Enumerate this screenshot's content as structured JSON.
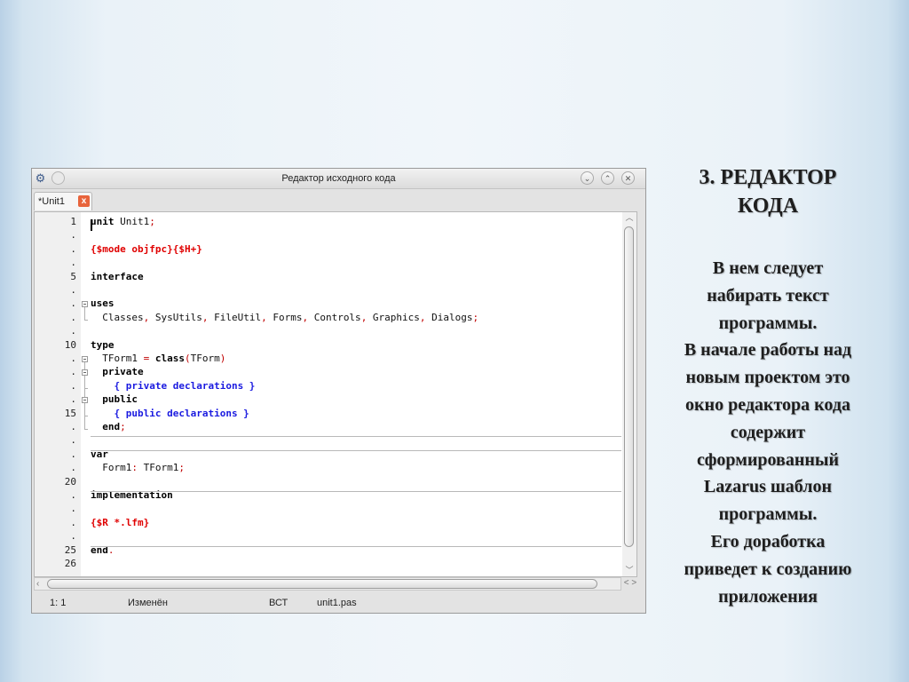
{
  "window": {
    "title": "Редактор исходного кода",
    "controls": [
      "chevron-down",
      "chevron-up",
      "close"
    ]
  },
  "tab": {
    "label": "*Unit1",
    "close_symbol": "x"
  },
  "editor": {
    "gutter": [
      {
        "row": 0,
        "label": "1"
      },
      {
        "row": 1,
        "label": "."
      },
      {
        "row": 2,
        "label": "."
      },
      {
        "row": 3,
        "label": "."
      },
      {
        "row": 4,
        "label": "5"
      },
      {
        "row": 5,
        "label": "."
      },
      {
        "row": 6,
        "label": "."
      },
      {
        "row": 7,
        "label": "."
      },
      {
        "row": 8,
        "label": "."
      },
      {
        "row": 9,
        "label": "10"
      },
      {
        "row": 10,
        "label": "."
      },
      {
        "row": 11,
        "label": "."
      },
      {
        "row": 12,
        "label": "."
      },
      {
        "row": 13,
        "label": "."
      },
      {
        "row": 14,
        "label": "15"
      },
      {
        "row": 15,
        "label": "."
      },
      {
        "row": 16,
        "label": "."
      },
      {
        "row": 17,
        "label": "."
      },
      {
        "row": 18,
        "label": "."
      },
      {
        "row": 19,
        "label": "20"
      },
      {
        "row": 20,
        "label": "."
      },
      {
        "row": 21,
        "label": "."
      },
      {
        "row": 22,
        "label": "."
      },
      {
        "row": 23,
        "label": "."
      },
      {
        "row": 24,
        "label": "25"
      },
      {
        "row": 25,
        "label": "26"
      }
    ],
    "lines": [
      {
        "row": 0,
        "tokens": [
          [
            "kw",
            "unit"
          ],
          [
            "t",
            " Unit1"
          ],
          [
            "sym",
            ";"
          ]
        ]
      },
      {
        "row": 2,
        "tokens": [
          [
            "dir",
            "{$mode objfpc}{$H+}"
          ]
        ]
      },
      {
        "row": 4,
        "tokens": [
          [
            "kw",
            "interface"
          ]
        ]
      },
      {
        "row": 6,
        "tokens": [
          [
            "kw",
            "uses"
          ]
        ]
      },
      {
        "row": 7,
        "tokens": [
          [
            "t",
            "  Classes"
          ],
          [
            "sym",
            ","
          ],
          [
            "t",
            " SysUtils"
          ],
          [
            "sym",
            ","
          ],
          [
            "t",
            " FileUtil"
          ],
          [
            "sym",
            ","
          ],
          [
            "t",
            " Forms"
          ],
          [
            "sym",
            ","
          ],
          [
            "t",
            " Controls"
          ],
          [
            "sym",
            ","
          ],
          [
            "t",
            " Graphics"
          ],
          [
            "sym",
            ","
          ],
          [
            "t",
            " Dialogs"
          ],
          [
            "sym",
            ";"
          ]
        ]
      },
      {
        "row": 9,
        "tokens": [
          [
            "kw",
            "type"
          ]
        ]
      },
      {
        "row": 10,
        "tokens": [
          [
            "t",
            "  TForm1 "
          ],
          [
            "sym",
            "="
          ],
          [
            "t",
            " "
          ],
          [
            "kw",
            "class"
          ],
          [
            "sym",
            "("
          ],
          [
            "t",
            "TForm"
          ],
          [
            "sym",
            ")"
          ]
        ]
      },
      {
        "row": 11,
        "tokens": [
          [
            "kw",
            "  private"
          ]
        ]
      },
      {
        "row": 12,
        "tokens": [
          [
            "cm",
            "    { private declarations }"
          ]
        ]
      },
      {
        "row": 13,
        "tokens": [
          [
            "kw",
            "  public"
          ]
        ]
      },
      {
        "row": 14,
        "tokens": [
          [
            "cm",
            "    { public declarations }"
          ]
        ]
      },
      {
        "row": 15,
        "tokens": [
          [
            "kw",
            "  end"
          ],
          [
            "sym",
            ";"
          ]
        ]
      },
      {
        "row": 17,
        "tokens": [
          [
            "kw",
            "var"
          ]
        ]
      },
      {
        "row": 18,
        "tokens": [
          [
            "t",
            "  Form1"
          ],
          [
            "sym",
            ":"
          ],
          [
            "t",
            " TForm1"
          ],
          [
            "sym",
            ";"
          ]
        ]
      },
      {
        "row": 20,
        "tokens": [
          [
            "kw",
            "implementation"
          ]
        ]
      },
      {
        "row": 22,
        "tokens": [
          [
            "dir",
            "{$R *.lfm}"
          ]
        ]
      },
      {
        "row": 24,
        "tokens": [
          [
            "kw",
            "end"
          ],
          [
            "sym",
            "."
          ]
        ]
      }
    ],
    "separator_after_rows": [
      15,
      16,
      19,
      23
    ]
  },
  "statusbar": {
    "position": "1:  1",
    "modified": "Изменён",
    "insert_mode": "ВСТ",
    "filename": "unit1.pas"
  },
  "slide": {
    "title_lines": [
      "3. РЕДАКТОР",
      "КОДА"
    ],
    "body_lines": [
      "В нем следует",
      "набирать текст",
      "программы.",
      "В начале работы над",
      "новым проектом это",
      "окно редактора кода",
      "содержит",
      "сформированный",
      "Lazarus шаблон",
      "программы.",
      "Его доработка",
      "приведет к созданию",
      "приложения"
    ]
  }
}
